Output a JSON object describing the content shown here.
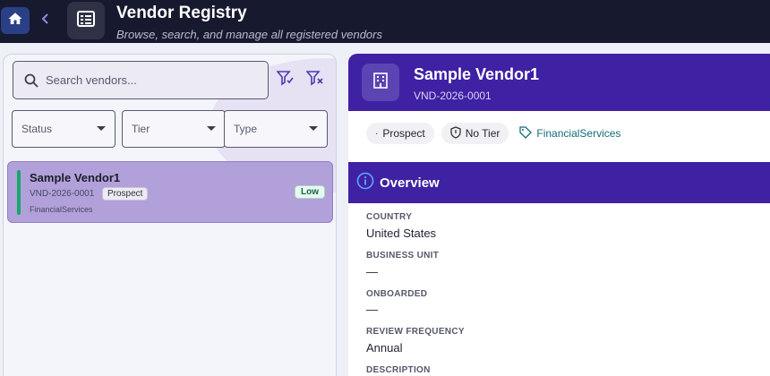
{
  "header": {
    "title": "Vendor Registry",
    "subtitle": "Browse, search, and manage all registered vendors",
    "icons": {
      "home": "home-icon",
      "back": "chevron-left-icon",
      "app": "table-list-icon"
    }
  },
  "search": {
    "placeholder": "Search vendors..."
  },
  "filters": {
    "status_label": "Status",
    "tier_label": "Tier",
    "type_label": "Type",
    "icons": {
      "apply": "filter-check-icon",
      "clear": "filter-clear-icon"
    }
  },
  "vendor_list": [
    {
      "name": "Sample Vendor1",
      "code": "VND-2026-0001",
      "stage": "Prospect",
      "category": "FinancialServices",
      "risk": "Low"
    }
  ],
  "detail": {
    "title": "Sample Vendor1",
    "code": "VND-2026-0001",
    "chips": {
      "stage": "Prospect",
      "tier": "No Tier",
      "category": "FinancialServices"
    },
    "section_title": "Overview",
    "fields": [
      {
        "label": "COUNTRY",
        "value": "United States"
      },
      {
        "label": "BUSINESS UNIT",
        "value": "—"
      },
      {
        "label": "ONBOARDED",
        "value": "—"
      },
      {
        "label": "REVIEW FREQUENCY",
        "value": "Annual"
      },
      {
        "label": "DESCRIPTION",
        "value": ""
      }
    ]
  },
  "colors": {
    "topbar": "#17192e",
    "accent_purple": "#3f21a3",
    "selected_card": "#b2a0da",
    "status_green": "#16a76a",
    "link_teal": "#136c78"
  }
}
